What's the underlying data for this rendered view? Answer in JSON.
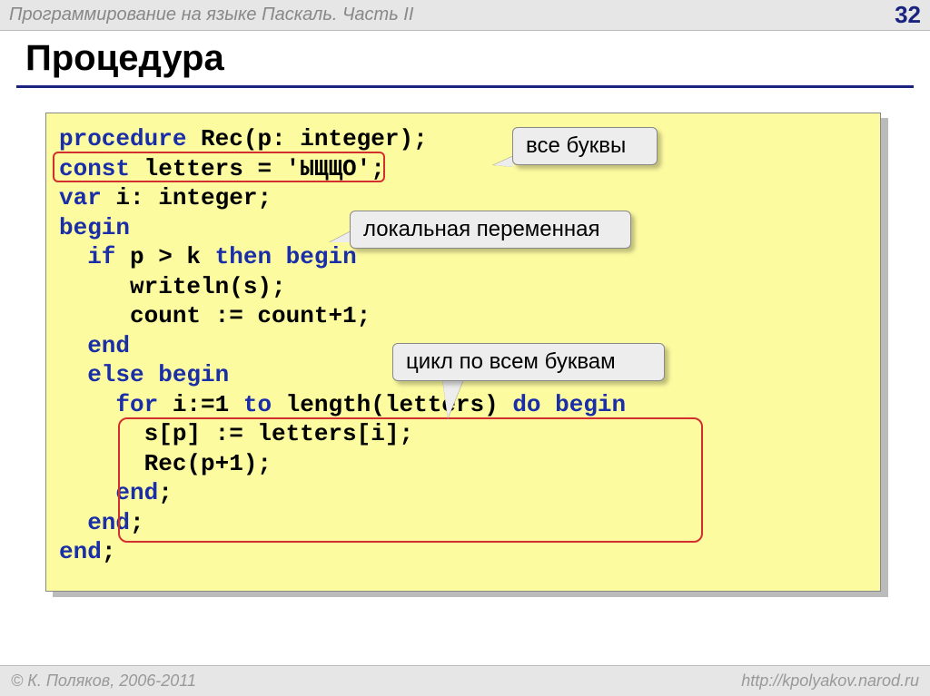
{
  "header": {
    "title": "Программирование на языке Паскаль. Часть II",
    "page": "32"
  },
  "slide": {
    "title": "Процедура"
  },
  "code": {
    "l1a": "procedure",
    "l1b": " Rec(p: integer);",
    "l2a": "const",
    "l2b": " letters = 'ЫЩЩО';",
    "l3a": "var",
    "l3b": " i: integer;",
    "l4": "begin",
    "l5a": "  if",
    "l5b": " p > k ",
    "l5c": "then begin",
    "l6": "     writeln(s);",
    "l7": "     count := count+1;",
    "l8": "  end",
    "l9a": "  else",
    "l9b": " begin",
    "l10a": "    for",
    "l10b": " i:=1 ",
    "l10c": "to",
    "l10d": " length(letters) ",
    "l10e": "do begin",
    "l11": "      s[p] := letters[i];",
    "l12": "      Rec(p+1);",
    "l13a": "    end",
    "l13b": ";",
    "l14a": "  end",
    "l14b": ";",
    "l15a": "end",
    "l15b": ";"
  },
  "callouts": {
    "c1": "все буквы",
    "c2": "локальная переменная",
    "c3": "цикл по всем буквам"
  },
  "footer": {
    "copyright": "© К. Поляков, 2006-2011",
    "url": "http://kpolyakov.narod.ru"
  }
}
